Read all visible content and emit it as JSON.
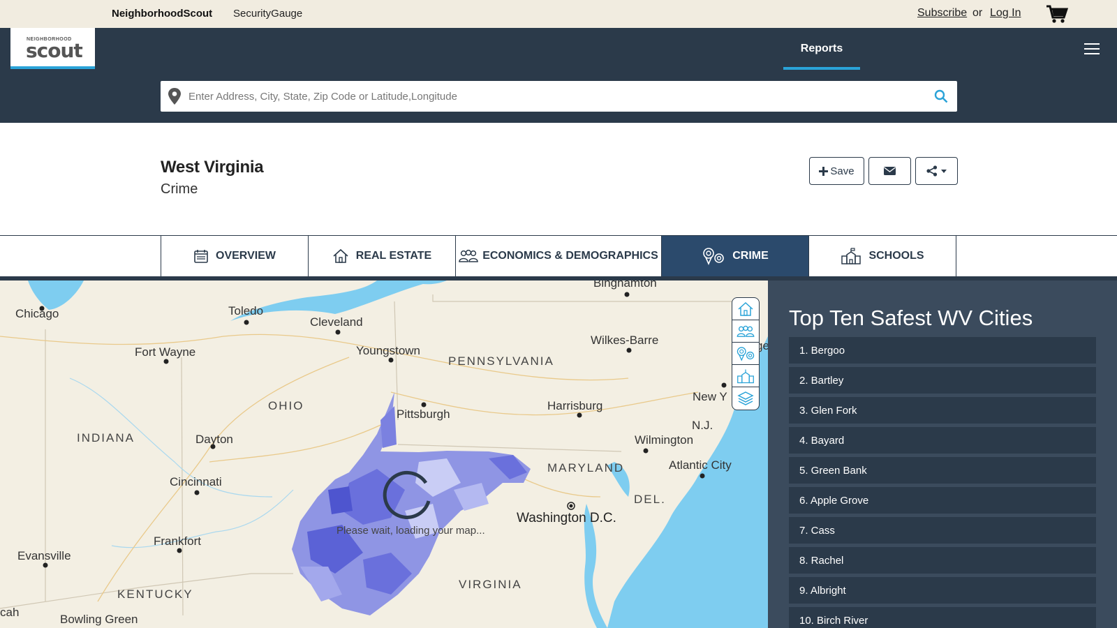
{
  "topbar": {
    "brand": "NeighborhoodScout",
    "securitygauge": "SecurityGauge",
    "subscribe": "Subscribe",
    "or": "or",
    "login": "Log In"
  },
  "nav": {
    "logo_small": "NEIGHBORHOOD",
    "logo_big": "scout",
    "reports": "Reports"
  },
  "search": {
    "placeholder": "Enter Address, City, State, Zip Code or Latitude,Longitude"
  },
  "page": {
    "title": "West Virginia",
    "subtitle": "Crime",
    "save_label": "Save"
  },
  "tabs": [
    {
      "label": "OVERVIEW",
      "icon": "calendar-icon"
    },
    {
      "label": "REAL ESTATE",
      "icon": "house-icon"
    },
    {
      "label": "ECONOMICS & DEMOGRAPHICS",
      "icon": "people-icon"
    },
    {
      "label": "CRIME",
      "icon": "crime-pins-icon"
    },
    {
      "label": "SCHOOLS",
      "icon": "school-icon"
    }
  ],
  "map": {
    "loading": "Please wait, loading your map...",
    "labels": {
      "chicago": "Chicago",
      "toledo": "Toledo",
      "cleveland": "Cleveland",
      "youngstown": "Youngstown",
      "fort_wayne": "Fort Wayne",
      "ohio": "OHIO",
      "pennsylvania": "PENNSYLVANIA",
      "binghamton": "Binghamton",
      "wilkes_barre": "Wilkes-Barre",
      "pittsburgh": "Pittsburgh",
      "harrisburg": "Harrisburg",
      "new_york": "New Y",
      "nj": "N.J.",
      "indiana": "INDIANA",
      "dayton": "Dayton",
      "wilmington": "Wilmington",
      "atlantic_city": "Atlantic City",
      "maryland": "MARYLAND",
      "cincinnati": "Cincinnati",
      "del": "DEL.",
      "washington": "Washington D.C.",
      "frankfort": "Frankfort",
      "evansville": "Evansville",
      "kentucky": "KENTUCKY",
      "virginia": "VIRGINIA",
      "bowling_green": "Bowling Green",
      "cah": "cah",
      "ge": "ge"
    },
    "colors": {
      "land": "#f3efe3",
      "water": "#7ecdf0",
      "wv_dark": "#5b62d6",
      "wv_light": "#c9cdf5"
    }
  },
  "sidebar": {
    "title": "Top Ten Safest WV Cities",
    "cities": [
      "1. Bergoo",
      "2. Bartley",
      "3. Glen Fork",
      "4. Bayard",
      "5. Green Bank",
      "6. Apple Grove",
      "7. Cass",
      "8. Rachel",
      "9. Albright",
      "10. Birch River"
    ]
  }
}
